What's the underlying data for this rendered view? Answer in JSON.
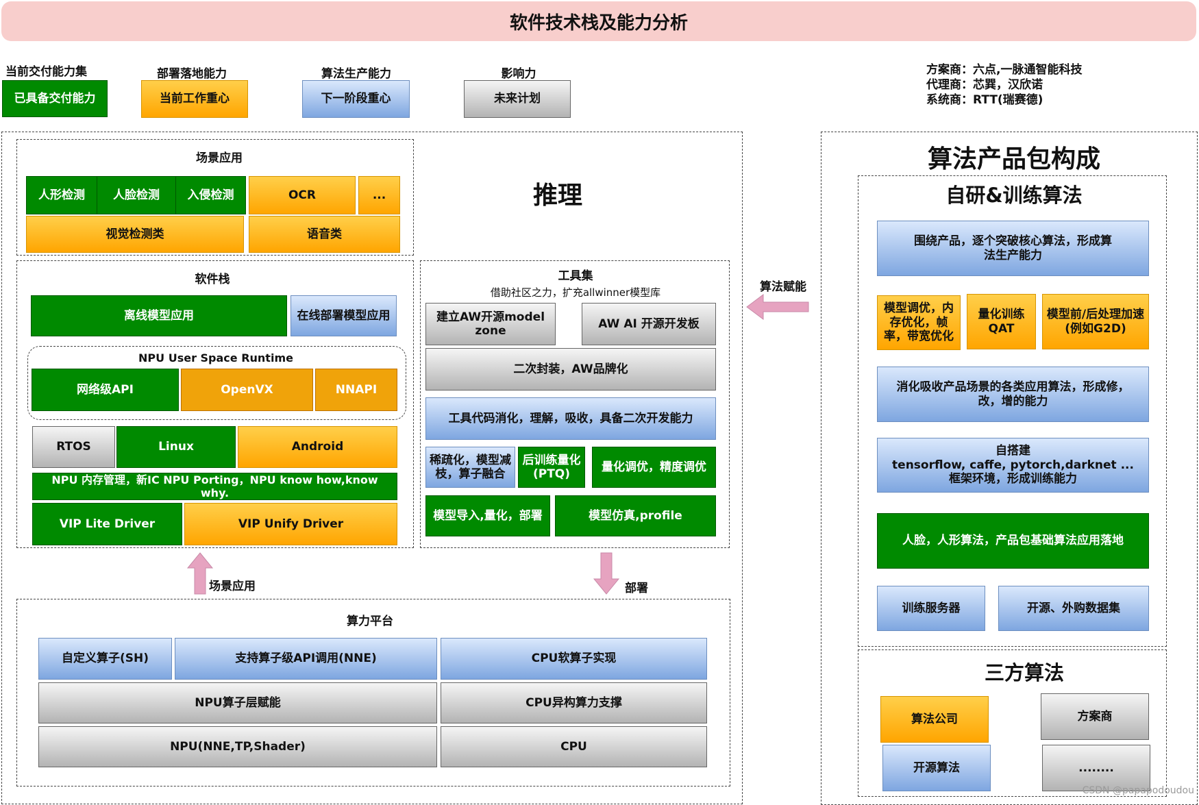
{
  "title": "软件技术栈及能力分析",
  "legend": {
    "items": [
      {
        "heading": "当前交付能力集",
        "label": "已具备交付能力"
      },
      {
        "heading": "部署落地能力",
        "label": "当前工作重心"
      },
      {
        "heading": "算法生产能力",
        "label": "下一阶段重心"
      },
      {
        "heading": "影响力",
        "label": "未来计划"
      }
    ]
  },
  "partners": {
    "line1": "方案商：六点,一脉通智能科技",
    "line2": "代理商：芯巽，汉欣诺",
    "line3": "系统商：RTT(瑞赛德)"
  },
  "inference": {
    "title": "推理",
    "scene": {
      "title": "场景应用",
      "human": "人形检测",
      "face": "人脸检测",
      "intrusion": "入侵检测",
      "ocr": "OCR",
      "more": "...",
      "vision": "视觉检测类",
      "voice": "语音类"
    },
    "stack": {
      "title": "软件栈",
      "offline": "离线模型应用",
      "online": "在线部署模型应用",
      "runtime_title": "NPU User Space Runtime",
      "net_api": "网络级API",
      "openvx": "OpenVX",
      "nnapi": "NNAPI",
      "rtos": "RTOS",
      "linux": "Linux",
      "android": "Android",
      "npu_mem": "NPU 内存管理，新IC NPU Porting，NPU know how,know why.",
      "vip_lite": "VIP Lite Driver",
      "vip_unify": "VIP Unify Driver"
    },
    "tools": {
      "title": "工具集",
      "subtitle": "借助社区之力，扩充allwinner模型库",
      "aw_zone": "建立AW开源model zone",
      "aw_board": "AW AI 开源开发板",
      "repack": "二次封装，AW品牌化",
      "digest": "工具代码消化，理解，吸收，具备二次开发能力",
      "sparse": "稀疏化，模型减枝，算子融合",
      "ptq": "后训练量化(PTQ)",
      "tune": "量化调优，精度调优",
      "import": "模型导入,量化，部署",
      "sim": "模型仿真,profile"
    },
    "arrow_scene": "场景应用",
    "arrow_deploy": "部署",
    "compute": {
      "title": "算力平台",
      "custom_op": "自定义算子(SH)",
      "nne_api": "支持算子级API调用(NNE)",
      "cpu_op": "CPU软算子实现",
      "npu_enable": "NPU算子层赋能",
      "cpu_hetero": "CPU异构算力支撑",
      "npu_hw": "NPU(NNE,TP,Shader)",
      "cpu": "CPU"
    }
  },
  "arrow_algo": "算法赋能",
  "product": {
    "title": "算法产品包构成",
    "self": {
      "title": "自研&训练算法",
      "core": "围绕产品，逐个突破核心算法，形成算法生产能力",
      "tune": "模型调优，内存优化，帧率，带宽优化",
      "qat": "量化训练QAT",
      "prepost": "模型前/后处理加速(例如G2D)",
      "absorb": "消化吸收产品场景的各类应用算法，形成修，改，增的能力",
      "framework_1": "自搭建",
      "framework_2": "tensorflow, caffe, pytorch,darknet ...",
      "framework_3": "框架环境，形成训练能力",
      "base": "人脸，人形算法，产品包基础算法应用落地",
      "server": "训练服务器",
      "dataset": "开源、外购数据集"
    },
    "third": {
      "title": "三方算法",
      "company": "算法公司",
      "vendor": "方案商",
      "open": "开源算法",
      "more": "........"
    }
  },
  "watermark": "CSDN @papapodoudou",
  "colors": {
    "green": "#008a00",
    "orange": "#ffa500",
    "blue": "#7ea6e0",
    "gray": "#b3b3b3",
    "title_bg": "#f8cecc",
    "arrow": "#e6a3c0"
  }
}
